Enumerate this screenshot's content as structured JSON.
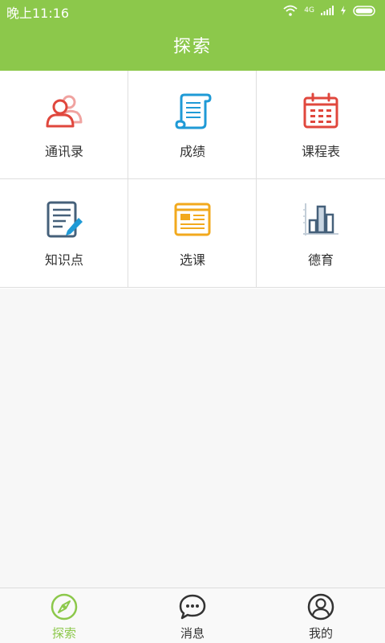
{
  "status_bar": {
    "time": "晚上11:16",
    "network_label": "4G"
  },
  "header": {
    "title": "探索"
  },
  "grid": {
    "items": [
      {
        "label": "通讯录",
        "icon": "contacts-icon",
        "color": "#e0473d"
      },
      {
        "label": "成绩",
        "icon": "scroll-icon",
        "color": "#1f9ad6"
      },
      {
        "label": "课程表",
        "icon": "calendar-icon",
        "color": "#e0473d"
      },
      {
        "label": "知识点",
        "icon": "notes-edit-icon",
        "color": "#45607a"
      },
      {
        "label": "选课",
        "icon": "course-window-icon",
        "color": "#f2a91d"
      },
      {
        "label": "德育",
        "icon": "bar-chart-icon",
        "color": "#45607a"
      }
    ]
  },
  "tabbar": {
    "tabs": [
      {
        "label": "探索",
        "icon": "compass-icon",
        "active": true
      },
      {
        "label": "消息",
        "icon": "chat-bubble-icon",
        "active": false
      },
      {
        "label": "我的",
        "icon": "profile-icon",
        "active": false
      }
    ]
  },
  "colors": {
    "accent": "#8cc84b",
    "background": "#f7f7f7",
    "divider": "#dedede"
  }
}
